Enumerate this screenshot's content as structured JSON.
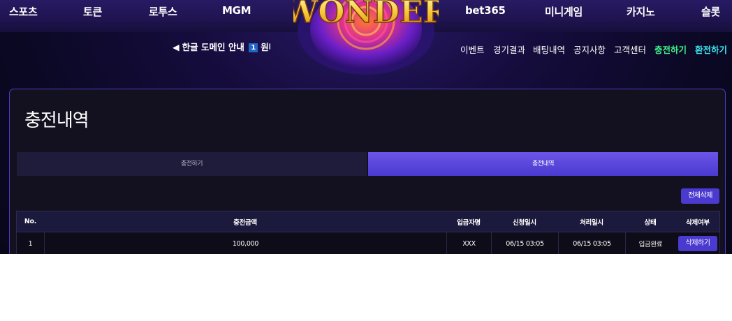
{
  "top_nav": {
    "items": [
      "스포츠",
      "토큰",
      "로투스",
      "MGM",
      "bet365",
      "미니게임",
      "카지노",
      "슬롯"
    ]
  },
  "logo": {
    "text": "WONDER"
  },
  "ticker": {
    "text": "한글 도메인 안내",
    "badge": "1",
    "trailing": "원다"
  },
  "sub_nav": {
    "items": [
      "이벤트",
      "경기결과",
      "배팅내역",
      "공지사항",
      "고객센터"
    ],
    "charge": "충전하기",
    "exchange": "환전하기"
  },
  "page": {
    "title": "충전내역"
  },
  "tabs": {
    "charge": "충전하기",
    "history": "충전내역"
  },
  "actions": {
    "delete_all": "전체삭제"
  },
  "table": {
    "headers": {
      "no": "No.",
      "amount": "충전금액",
      "depositor": "입금자명",
      "requested": "신청일시",
      "processed": "처리일시",
      "status": "상태",
      "delete": "삭제여부"
    },
    "rows": [
      {
        "no": "1",
        "amount": "100,000",
        "depositor": "XXX",
        "requested": "06/15 03:05",
        "processed": "06/15 03:05",
        "status": "입금완료",
        "delete_label": "삭제하기"
      }
    ]
  },
  "colors": {
    "accent": "#4b3ad0",
    "charge_green": "#3df28a",
    "exchange_cyan": "#3ce8f0"
  }
}
